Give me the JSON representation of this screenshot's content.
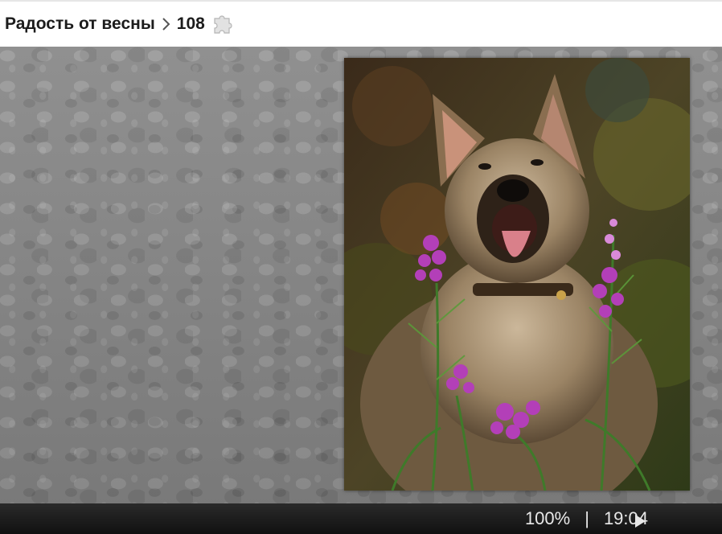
{
  "header": {
    "title": "Радость от весны",
    "piece_count": "108",
    "breadcrumb_separator_icon": "chevron-right-icon",
    "puzzle_icon": "puzzle-piece-icon"
  },
  "board": {
    "background_color": "#8a8a8a",
    "photo_description_icon": "dog-with-flowers-image"
  },
  "footer": {
    "zoom": "100%",
    "separator": "|",
    "timer": "19:04",
    "play_icon": "play-icon"
  }
}
